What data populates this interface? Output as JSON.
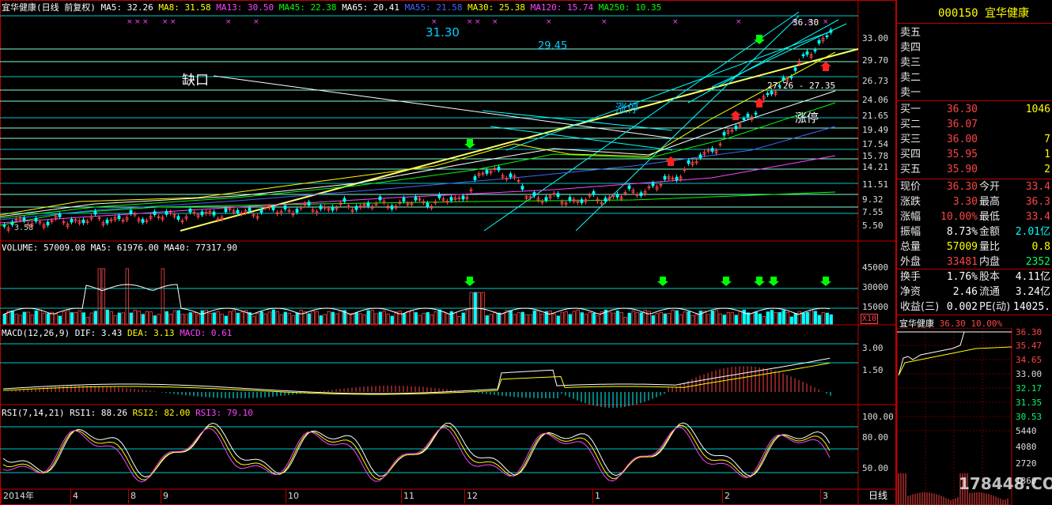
{
  "main_header": {
    "title": "宜华健康(日线 前复权)",
    "mas": [
      {
        "label": "MA5: 32.26",
        "color": "#ffffff"
      },
      {
        "label": "MA8: 31.58",
        "color": "#ffff00"
      },
      {
        "label": "MA13: 30.50",
        "color": "#ff44ff"
      },
      {
        "label": "MA45: 22.38",
        "color": "#00ff00"
      },
      {
        "label": "MA65: 20.41",
        "color": "#ffffff"
      },
      {
        "label": "MA55: 21.58",
        "color": "#4466ff"
      },
      {
        "label": "MA30: 25.38",
        "color": "#ffff00"
      },
      {
        "label": "MA120: 15.74",
        "color": "#ff44ff"
      },
      {
        "label": "MA250: 10.35",
        "color": "#00ff00"
      }
    ]
  },
  "price_axis": [
    "33.00",
    "29.70",
    "26.73",
    "24.06",
    "21.65",
    "19.49",
    "17.54",
    "15.78",
    "14.21",
    "11.51",
    "9.32",
    "7.55",
    "5.50"
  ],
  "annotations": {
    "gap": "缺口",
    "limit_up_1": "涨停",
    "limit_up_2": "涨停",
    "level_a": "31.30",
    "level_b": "29.45",
    "level_c": "36.30",
    "range": "27.26 - 27.35",
    "low_mark": "3.58"
  },
  "volume_header": {
    "items": [
      {
        "label": "VOLUME: 57009.08",
        "color": "#ffffff"
      },
      {
        "label": "MA5: 61976.00",
        "color": "#ffffff"
      },
      {
        "label": "MA40: 77317.90",
        "color": "#ffffff"
      }
    ],
    "axis": [
      "45000",
      "30000",
      "15000"
    ],
    "unit": "X10"
  },
  "macd_header": {
    "items": [
      {
        "label": "MACD(12,26,9)",
        "color": "#ffffff"
      },
      {
        "label": "DIF: 3.43",
        "color": "#ffffff"
      },
      {
        "label": "DEA: 3.13",
        "color": "#ffff00"
      },
      {
        "label": "MACD: 0.61",
        "color": "#ff44ff"
      }
    ],
    "axis": [
      "3.00",
      "1.50"
    ]
  },
  "rsi_header": {
    "items": [
      {
        "label": "RSI(7,14,21)",
        "color": "#ffffff"
      },
      {
        "label": "RSI1: 88.26",
        "color": "#ffffff"
      },
      {
        "label": "RSI2: 82.00",
        "color": "#ffff00"
      },
      {
        "label": "RSI3: 79.10",
        "color": "#ff44ff"
      }
    ],
    "axis": [
      "100.00",
      "80.00",
      "50.00"
    ]
  },
  "time_axis": [
    "2014年",
    "4",
    "8",
    "9",
    "10",
    "11",
    "12",
    "1",
    "2",
    "3"
  ],
  "period_label": "日线",
  "quote": {
    "code": "000150",
    "name": "宜华健康",
    "sells": [
      {
        "label": "卖五"
      },
      {
        "label": "卖四"
      },
      {
        "label": "卖三"
      },
      {
        "label": "卖二"
      },
      {
        "label": "卖一"
      }
    ],
    "buys": [
      {
        "label": "买一",
        "price": "36.30",
        "vol": "1046"
      },
      {
        "label": "买二",
        "price": "36.07",
        "vol": ""
      },
      {
        "label": "买三",
        "price": "36.00",
        "vol": "7"
      },
      {
        "label": "买四",
        "price": "35.95",
        "vol": "1"
      },
      {
        "label": "买五",
        "price": "35.90",
        "vol": "2"
      }
    ],
    "stats": [
      {
        "l1": "现价",
        "v1": "36.30",
        "c1": "red",
        "l2": "今开",
        "v2": "33.4",
        "c2": "red"
      },
      {
        "l1": "涨跌",
        "v1": "3.30",
        "c1": "red",
        "l2": "最高",
        "v2": "36.3",
        "c2": "red"
      },
      {
        "l1": "涨幅",
        "v1": "10.00%",
        "c1": "red",
        "l2": "最低",
        "v2": "33.4",
        "c2": "red"
      },
      {
        "l1": "振幅",
        "v1": "8.73%",
        "c1": "wht",
        "l2": "金额",
        "v2": "2.01亿",
        "c2": "cyn"
      },
      {
        "l1": "总量",
        "v1": "57009",
        "c1": "yel",
        "l2": "量比",
        "v2": "0.8",
        "c2": "yel"
      },
      {
        "l1": "外盘",
        "v1": "33481",
        "c1": "red",
        "l2": "内盘",
        "v2": "2352",
        "c2": "grn"
      }
    ],
    "stats2": [
      {
        "l1": "换手",
        "v1": "1.76%",
        "l2": "股本",
        "v2": "4.11亿"
      },
      {
        "l1": "净资",
        "v1": "2.46",
        "l2": "流通",
        "v2": "3.24亿"
      },
      {
        "l1": "收益(三)",
        "v1": "0.002",
        "l2": "PE(动)",
        "v2": "14025."
      }
    ],
    "mini_header": {
      "name": "宜华健康",
      "price": "36.30",
      "pct": "10.00%"
    },
    "mini_axis": [
      "36.30",
      "35.47",
      "34.65",
      "33.00",
      "32.17",
      "31.35",
      "30.53",
      "5440",
      "4080",
      "2720",
      "1360"
    ],
    "watermark": "178448.COM"
  }
}
